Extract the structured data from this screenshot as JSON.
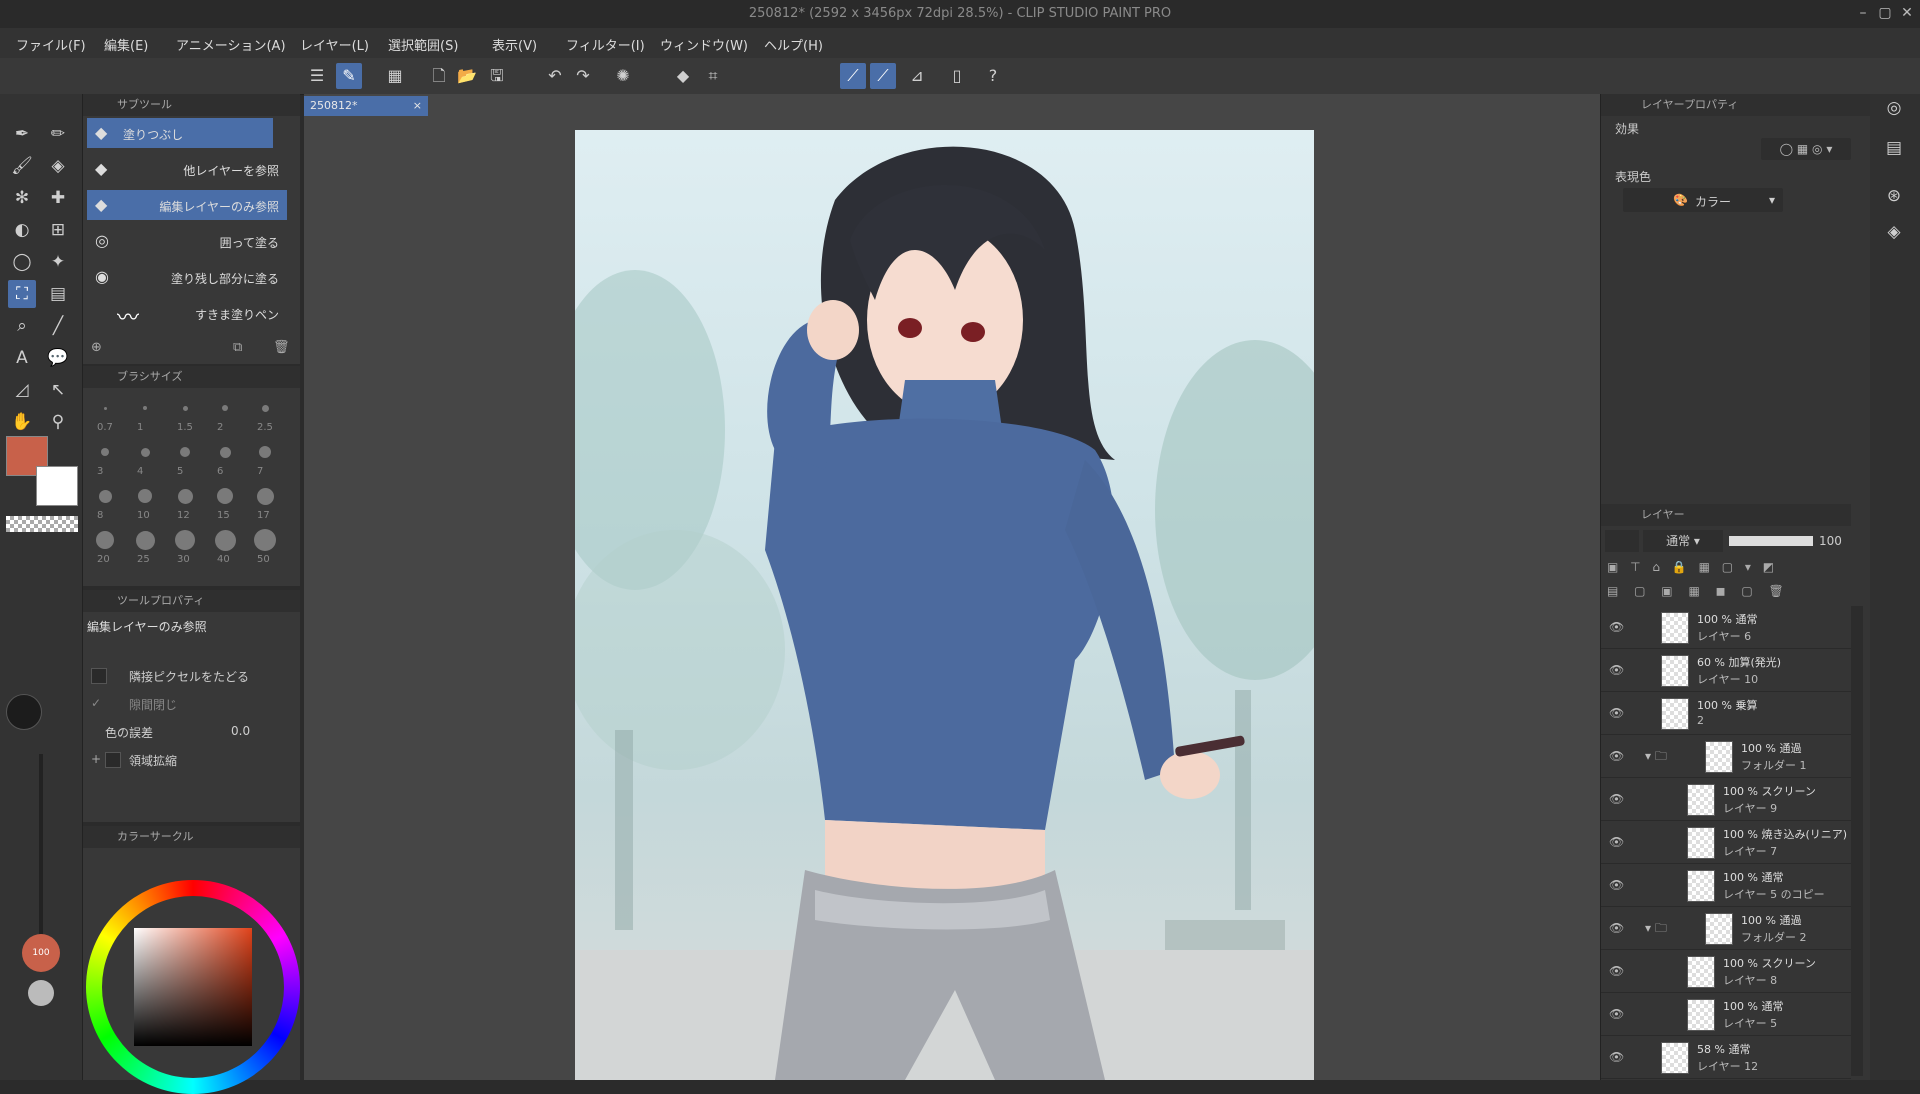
{
  "window": {
    "title": "250812* (2592 x 3456px 72dpi 28.5%) - CLIP STUDIO PAINT PRO"
  },
  "menu": [
    "ファイル(F)",
    "編集(E)",
    "アニメーション(A)",
    "レイヤー(L)",
    "選択範囲(S)",
    "表示(V)",
    "フィルター(I)",
    "ウィンドウ(W)",
    "ヘルプ(H)"
  ],
  "document_tab": "250812*",
  "subtool_panel": {
    "header": "サブツール",
    "items": [
      {
        "label": "塗りつぶし",
        "selected": true
      },
      {
        "label": "他レイヤーを参照",
        "selected": false
      },
      {
        "label": "編集レイヤーのみ参照",
        "selected": true
      },
      {
        "label": "囲って塗る",
        "selected": false
      },
      {
        "label": "塗り残し部分に塗る",
        "selected": false
      },
      {
        "label": "すきま塗りペン",
        "selected": false
      }
    ]
  },
  "brush_size_panel": {
    "header": "ブラシサイズ",
    "sizes": [
      "0.7",
      "1",
      "1.5",
      "2",
      "2.5",
      "3",
      "4",
      "5",
      "6",
      "7",
      "8",
      "10",
      "12",
      "15",
      "17",
      "20",
      "25",
      "30",
      "40",
      "50"
    ]
  },
  "tool_property": {
    "header": "ツールプロパティ",
    "subtool_name": "編集レイヤーのみ参照",
    "options": [
      {
        "label": "隣接ピクセルをたどる",
        "value": ""
      },
      {
        "label": "隙間閉じ",
        "value": ""
      },
      {
        "label": "色の誤差",
        "value": "0.0"
      },
      {
        "label": "領域拡縮",
        "value": ""
      }
    ]
  },
  "color_panel": {
    "header": "カラーサークル",
    "main_color": "#c8614a",
    "sub_color": "#ffffff",
    "opacity_label": "100"
  },
  "layer_property": {
    "header": "レイヤープロパティ",
    "effect_label": "効果",
    "expression_label": "表現色",
    "expression_value": "カラー"
  },
  "layer_panel": {
    "header": "レイヤー",
    "blend_mode": "通常",
    "opacity": "100",
    "layers": [
      {
        "line1": "100 % 通常",
        "line2": "レイヤー 6",
        "folder": false,
        "indent": 0
      },
      {
        "line1": "60 % 加算(発光)",
        "line2": "レイヤー 10",
        "folder": false,
        "indent": 0
      },
      {
        "line1": "100 % 乗算",
        "line2": "2",
        "folder": false,
        "indent": 0
      },
      {
        "line1": "100 % 通過",
        "line2": "フォルダー 1",
        "folder": true,
        "indent": 0
      },
      {
        "line1": "100 % スクリーン",
        "line2": "レイヤー 9",
        "folder": false,
        "indent": 1
      },
      {
        "line1": "100 % 焼き込み(リニア)",
        "line2": "レイヤー 7",
        "folder": false,
        "indent": 1
      },
      {
        "line1": "100 % 通常",
        "line2": "レイヤー 5 のコピー",
        "folder": false,
        "indent": 1
      },
      {
        "line1": "100 % 通過",
        "line2": "フォルダー 2",
        "folder": true,
        "indent": 0
      },
      {
        "line1": "100 % スクリーン",
        "line2": "レイヤー 8",
        "folder": false,
        "indent": 1
      },
      {
        "line1": "100 % 通常",
        "line2": "レイヤー 5",
        "folder": false,
        "indent": 1
      },
      {
        "line1": "58 % 通常",
        "line2": "レイヤー 12",
        "folder": false,
        "indent": 0
      }
    ]
  }
}
